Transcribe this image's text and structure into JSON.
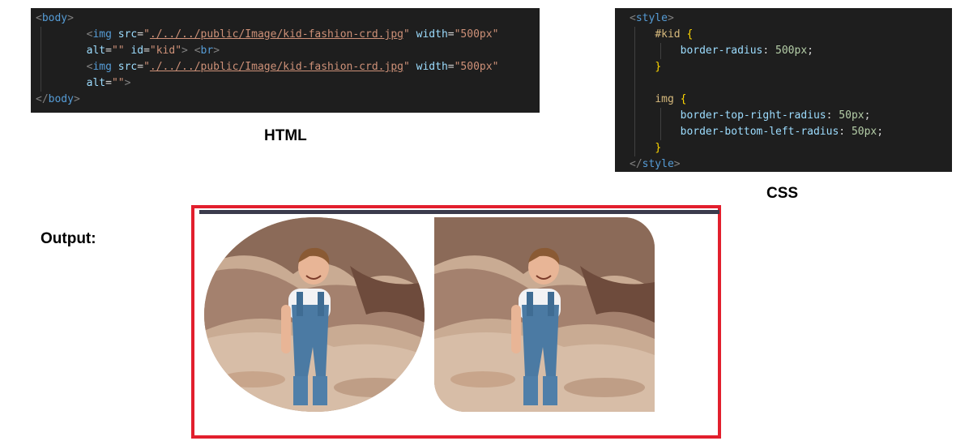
{
  "html_code": {
    "line1": {
      "open": "<",
      "tag": "body",
      "close": ">"
    },
    "line2": {
      "open": "<",
      "tag": "img",
      "attr_src": "src",
      "eq": "=",
      "q": "\"",
      "src_value": "./../../public/Image/kid-fashion-crd.jpg",
      "attr_width": "width",
      "width_value": "\"500px\""
    },
    "line3": {
      "attr_alt": "alt",
      "eq": "=",
      "alt_value": "\"\"",
      "attr_id": "id",
      "id_value": "\"kid\"",
      "close": ">",
      "br_open": "<",
      "br": "br",
      "br_close": ">"
    },
    "line4": {
      "open": "<",
      "tag": "img",
      "attr_src": "src",
      "eq": "=",
      "q": "\"",
      "src_value": "./../../public/Image/kid-fashion-crd.jpg",
      "attr_width": "width",
      "width_value": "\"500px\""
    },
    "line5": {
      "attr_alt": "alt",
      "eq": "=",
      "alt_value": "\"\"",
      "close": ">"
    },
    "line6": {
      "open": "</",
      "tag": "body",
      "close": ">"
    }
  },
  "css_code": {
    "style_open": {
      "open": "<",
      "tag": "style",
      "close": ">"
    },
    "rule1_selector": "#kid",
    "rule1_brace_open": "{",
    "rule1_prop": "border-radius",
    "rule1_colon": ":",
    "rule1_value": "500px",
    "rule1_semi": ";",
    "rule1_brace_close": "}",
    "rule2_selector": "img",
    "rule2_brace_open": "{",
    "rule2_prop1": "border-top-right-radius",
    "rule2_colon": ":",
    "rule2_value1": "50px",
    "rule2_semi": ";",
    "rule2_prop2": "border-bottom-left-radius",
    "rule2_value2": "50px",
    "rule2_brace_close": "}",
    "style_close": {
      "open": "</",
      "tag": "style",
      "close": ">"
    }
  },
  "labels": {
    "html": "HTML",
    "css": "CSS",
    "output": "Output:"
  },
  "output": {
    "frame_color": "#e21f2d",
    "images": [
      {
        "shape": "ellipse",
        "subject": "smiling toddler in denim overalls on rocky ground"
      },
      {
        "shape": "rounded-top-right-bottom-left",
        "subject": "smiling toddler in denim overalls on rocky ground"
      }
    ]
  }
}
